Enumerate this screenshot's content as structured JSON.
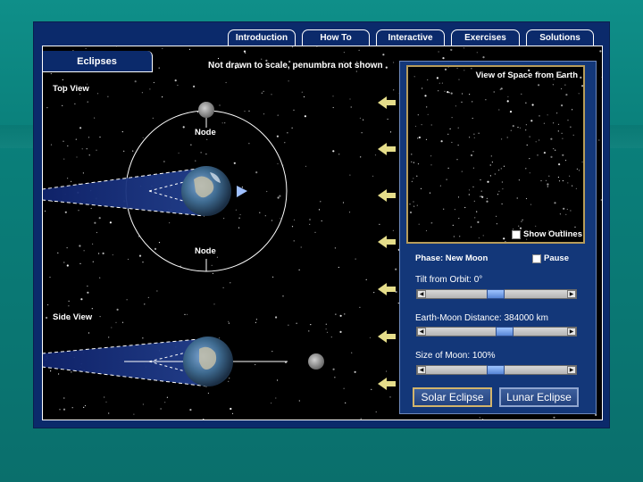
{
  "tabs": [
    "Introduction",
    "How To",
    "Interactive",
    "Exercises",
    "Solutions"
  ],
  "active_tab": "Interactive",
  "section_tab": "Eclipses",
  "note": "Not drawn to scale, penumbra not shown",
  "top_view_label": "Top View",
  "side_view_label": "Side View",
  "node_label_top": "Node",
  "node_label_bottom": "Node",
  "space_view_title": "View of Space from Earth",
  "show_outlines_label": "Show Outlines",
  "phase_label": "Phase: New Moon",
  "pause_label": "Pause",
  "tilt_label": "Tilt from Orbit: 0°",
  "distance_label": "Earth-Moon Distance: 384000 km",
  "size_label": "Size of Moon: 100%",
  "solar_button": "Solar Eclipse",
  "lunar_button": "Lunar Eclipse",
  "colors": {
    "frame_blue": "#0b2a6b",
    "panel_blue": "#133779",
    "arrow_yellow": "#e5dd8a",
    "accent_gold": "#b79c5a"
  }
}
